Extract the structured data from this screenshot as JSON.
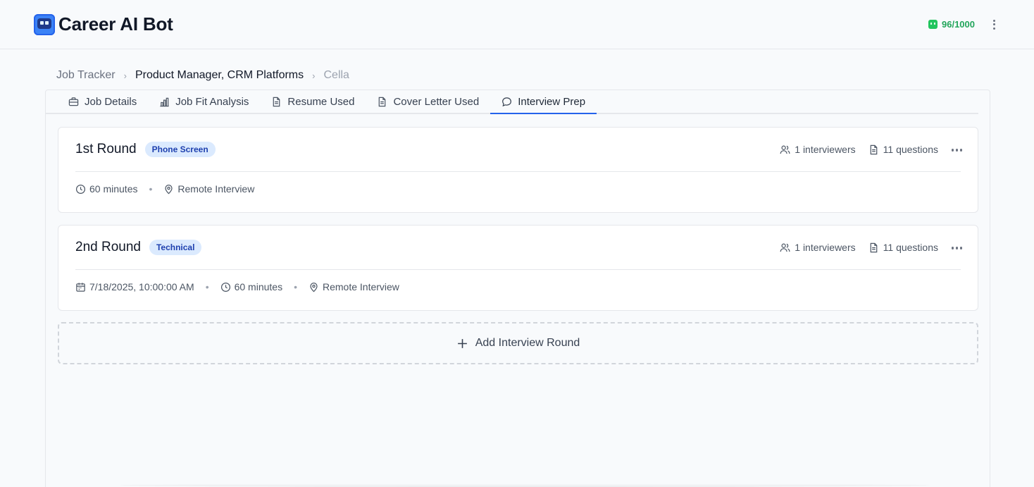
{
  "app": {
    "title": "Career AI Bot",
    "credits": "96/1000"
  },
  "breadcrumb": {
    "root": "Job Tracker",
    "job": "Product Manager, CRM Platforms",
    "company": "Cella"
  },
  "tabs": [
    {
      "label": "Job Details",
      "icon": "briefcase-icon"
    },
    {
      "label": "Job Fit Analysis",
      "icon": "bar-chart-icon"
    },
    {
      "label": "Resume Used",
      "icon": "document-icon"
    },
    {
      "label": "Cover Letter Used",
      "icon": "document-icon"
    },
    {
      "label": "Interview Prep",
      "icon": "chat-bubble-icon",
      "active": true
    }
  ],
  "rounds": [
    {
      "title": "1st Round",
      "badge": "Phone Screen",
      "interviewers": "1 interviewers",
      "questions": "11 questions",
      "duration": "60 minutes",
      "location": "Remote Interview"
    },
    {
      "title": "2nd Round",
      "badge": "Technical",
      "interviewers": "1 interviewers",
      "questions": "11 questions",
      "datetime": "7/18/2025, 10:00:00 AM",
      "duration": "60 minutes",
      "location": "Remote Interview"
    }
  ],
  "add_round_label": "Add Interview Round",
  "colors": {
    "accent": "#2563eb",
    "badge_bg": "#dbeafe",
    "badge_text": "#1e40af",
    "credits": "#22a55a"
  }
}
